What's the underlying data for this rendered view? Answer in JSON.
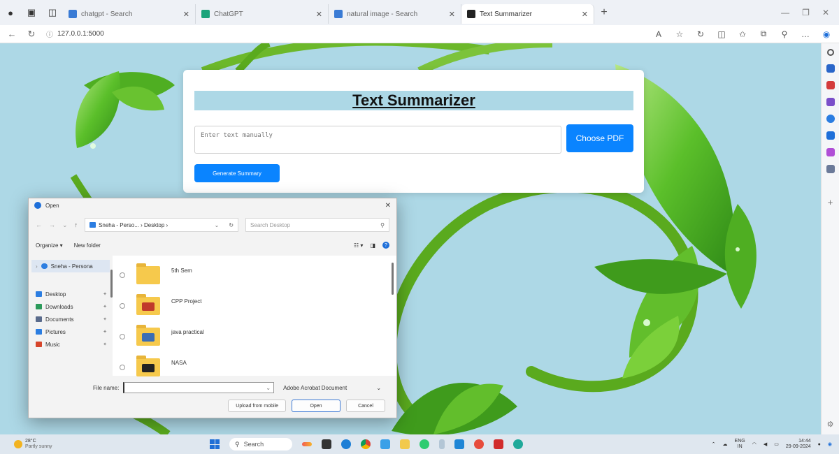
{
  "browser": {
    "tabs": [
      {
        "title": "chatgpt - Search",
        "favicon": "search-favicon",
        "color": "#3a7bd5",
        "active": false
      },
      {
        "title": "ChatGPT",
        "favicon": "chatgpt-favicon",
        "color": "#1aa37a",
        "active": false
      },
      {
        "title": "natural image - Search",
        "favicon": "search-favicon",
        "color": "#3a7bd5",
        "active": false
      },
      {
        "title": "Text Summarizer",
        "favicon": "page-favicon",
        "color": "#222222",
        "active": true
      }
    ],
    "url": "127.0.0.1:5000"
  },
  "app": {
    "title": "Text Summarizer",
    "textarea_placeholder": "Enter text manually",
    "choose_pdf_label": "Choose PDF",
    "generate_label": "Generate Summary",
    "accent_color": "#0a84ff",
    "title_band_color": "#add8e6"
  },
  "dialog": {
    "title": "Open",
    "path": "Sneha - Perso... › Desktop ›",
    "search_placeholder": "Search Desktop",
    "organize_label": "Organize ▾",
    "new_folder_label": "New folder",
    "nav_top": "Sneha - Persona",
    "quick_access": [
      {
        "label": "Desktop",
        "icon": "desktop-icon",
        "color": "#2b7de1"
      },
      {
        "label": "Downloads",
        "icon": "download-icon",
        "color": "#2b9a5a"
      },
      {
        "label": "Documents",
        "icon": "document-icon",
        "color": "#5a6b8c"
      },
      {
        "label": "Pictures",
        "icon": "pictures-icon",
        "color": "#2b7de1"
      },
      {
        "label": "Music",
        "icon": "music-icon",
        "color": "#d6452b"
      }
    ],
    "files": [
      {
        "name": "5th Sem",
        "thumb": ""
      },
      {
        "name": "CPP Project",
        "thumb": "#c0392b"
      },
      {
        "name": "java practical",
        "thumb": "#3a6db5"
      },
      {
        "name": "NASA",
        "thumb": "#222222"
      }
    ],
    "filename_label": "File name:",
    "filename_value": "",
    "filetype": "Adobe Acrobat Document",
    "upload_label": "Upload from mobile",
    "open_label": "Open",
    "cancel_label": "Cancel"
  },
  "taskbar": {
    "weather_temp": "28°C",
    "weather_desc": "Partly sunny",
    "search_label": "Search",
    "lang_1": "ENG",
    "lang_2": "IN",
    "time": "14:44",
    "date": "29-09-2024"
  }
}
